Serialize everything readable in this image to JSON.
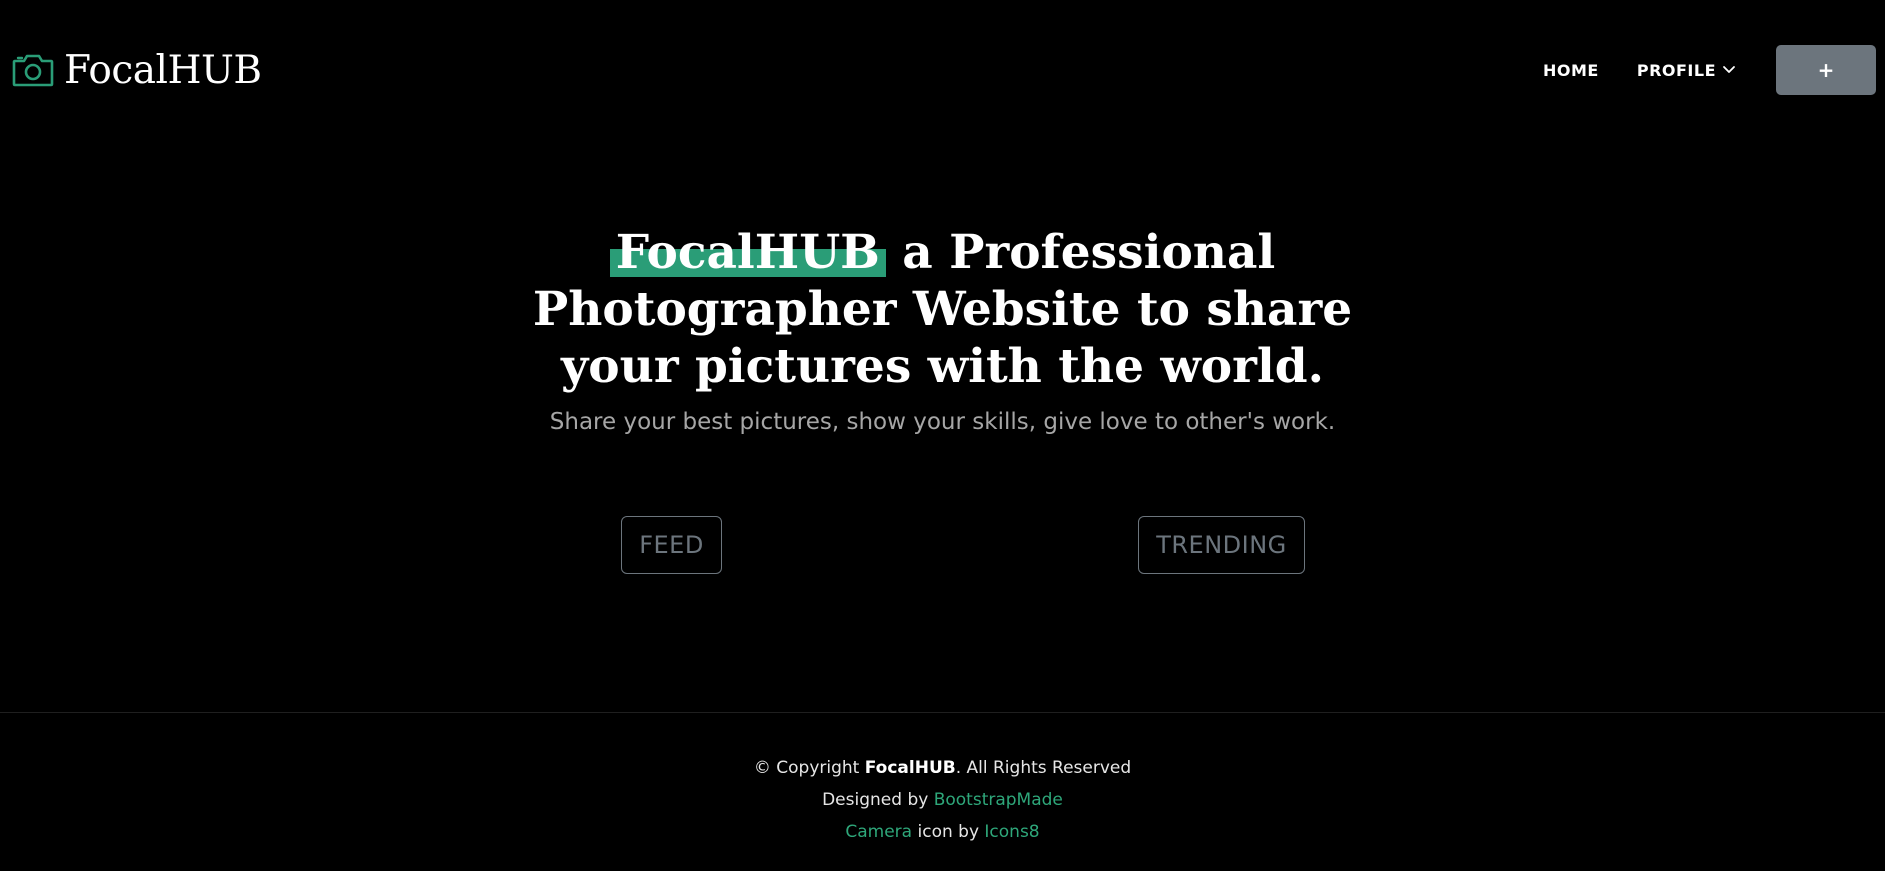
{
  "brand": {
    "name": "FocalHUB",
    "icon": "camera-icon",
    "accent_color": "#2a9d77"
  },
  "nav": {
    "home_label": "HOME",
    "profile_label": "PROFILE",
    "add_label": "+"
  },
  "hero": {
    "title_highlight": "FocalHUB",
    "title_rest": " a Professional Photographer Website to share your pictures with the world.",
    "subtitle": "Share your best pictures, show your skills, give love to other's work.",
    "feed_label": "FEED",
    "trending_label": "TRENDING"
  },
  "footer": {
    "copyright_prefix": "© Copyright ",
    "copyright_brand": "FocalHUB",
    "copyright_suffix": ". All Rights Reserved",
    "designed_prefix": "Designed by ",
    "designed_link": "BootstrapMade",
    "icon_link": "Camera",
    "icon_middle": " icon by ",
    "icon_source_link": "Icons8"
  },
  "colors": {
    "background": "#000000",
    "accent": "#2a9d77",
    "button_gray": "#6c757d",
    "subtitle_gray": "#a6a6a6"
  }
}
